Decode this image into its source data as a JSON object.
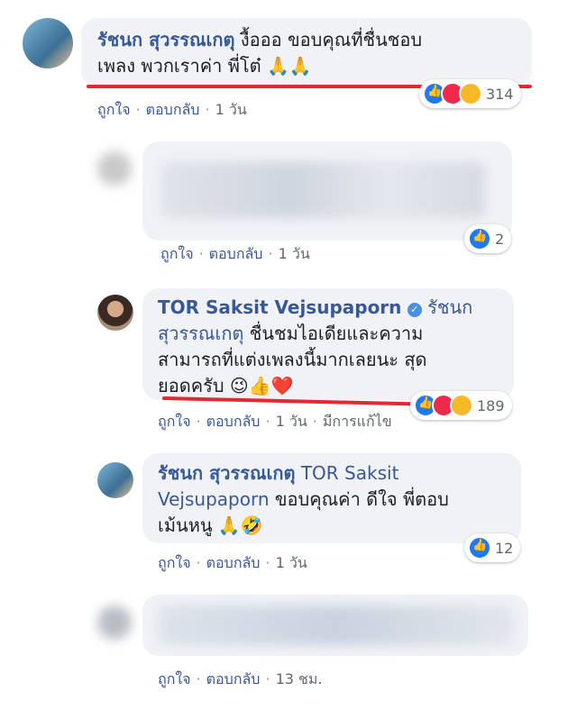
{
  "comments": [
    {
      "author": "รัชนก สุวรรณเกตุ",
      "text": " งื้อออ ขอบคุณที่ชื่นชอบ",
      "text2": "เพลง พวกเราค่า พี่โต๋ 🙏🙏",
      "actions": {
        "like": "ถูกใจ",
        "reply": "ตอบกลับ",
        "time": "1 วัน"
      },
      "reaction_count": "314"
    },
    {
      "author": "",
      "text": "",
      "actions": {
        "like": "ถูกใจ",
        "reply": "ตอบกลับ",
        "time": "1 วัน"
      },
      "reaction_count": "2"
    },
    {
      "author": "TOR Saksit Vejsupaporn",
      "mention": "รัชนก",
      "mention2": "สุวรรณเกตุ",
      "line2_rest": " ชื่นชมไอเดียและความ",
      "line3": "สามารถที่แต่งเพลงนี้มากเลยนะ สุด",
      "line4": "ยอดครับ 😉👍❤️",
      "actions": {
        "like": "ถูกใจ",
        "reply": "ตอบกลับ",
        "time": "1 วัน",
        "extra": "มีการแก้ไข"
      },
      "reaction_count": "189"
    },
    {
      "author": "รัชนก สุวรรณเกตุ",
      "mention": "TOR Saksit",
      "mention2": "Vejsupaporn",
      "line2_rest": " ขอบคุณค่า ดีใจ พี่ตอบ",
      "line3": "เม้นหนู 🙏🤣",
      "actions": {
        "like": "ถูกใจ",
        "reply": "ตอบกลับ",
        "time": "1 วัน"
      },
      "reaction_count": "12"
    },
    {
      "author": "",
      "text": "",
      "actions": {
        "like": "ถูกใจ",
        "reply": "ตอบกลับ",
        "time": "13 ชม."
      }
    }
  ],
  "colors": {
    "bubble": "#f0f2f5",
    "link": "#385898",
    "underline": "#e4282f",
    "like": "#2078f4"
  }
}
